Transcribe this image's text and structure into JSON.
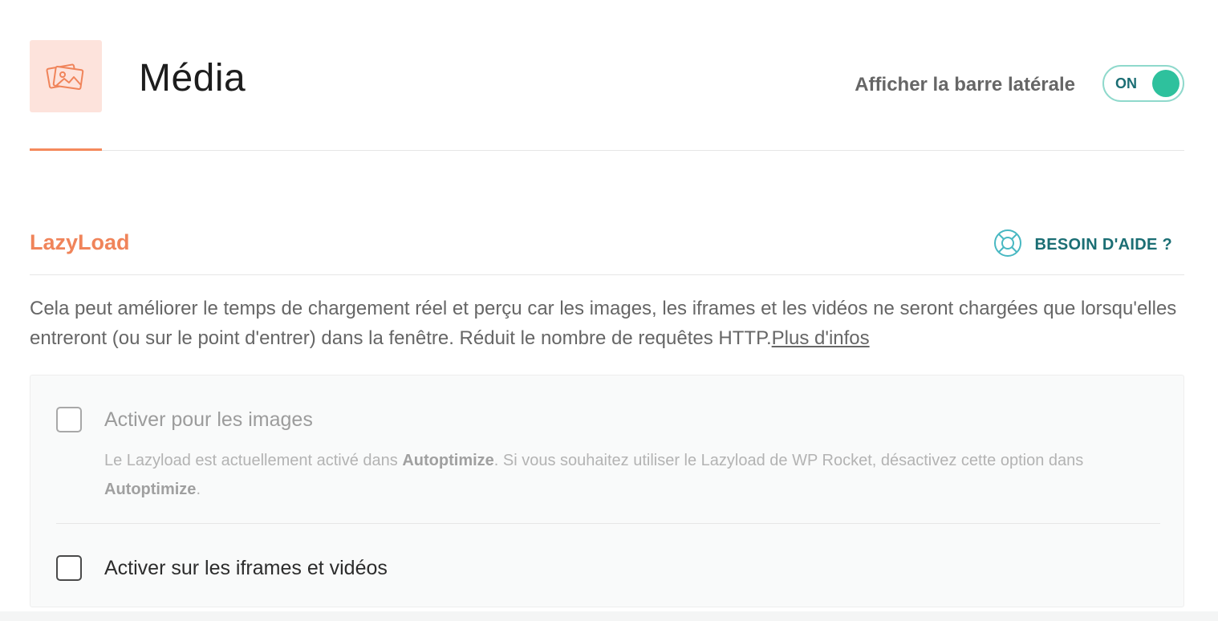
{
  "header": {
    "title": "Média",
    "icon": "media-images-icon",
    "sidebar_toggle_label": "Afficher la barre latérale",
    "sidebar_toggle_state": "ON"
  },
  "colors": {
    "accent": "#f0845a",
    "icon_bg": "#fde3dc",
    "teal_dark": "#1b6e74",
    "toggle_on": "#2ec19d"
  },
  "section": {
    "title": "LazyLoad",
    "help_label": "BESOIN D'AIDE ?",
    "help_icon": "lifebuoy-icon",
    "description": "Cela peut améliorer le temps de chargement réel et perçu car les images, les iframes et les vidéos ne seront chargées que lorsqu'elles entreront (ou sur le point d'entrer) dans la fenêtre. Réduit le nombre de requêtes HTTP.",
    "more_info_link": "Plus d'infos"
  },
  "options": [
    {
      "label": "Activer pour les images",
      "checked": false,
      "disabled": true,
      "note_prefix": "Le Lazyload est actuellement activé dans ",
      "note_plugin_1": "Autoptimize",
      "note_middle": ". Si vous souhaitez utiliser le Lazyload de WP Rocket, désactivez cette option dans ",
      "note_plugin_2": "Autoptimize",
      "note_suffix": "."
    },
    {
      "label": "Activer sur les iframes et vidéos",
      "checked": false,
      "disabled": false
    }
  ]
}
